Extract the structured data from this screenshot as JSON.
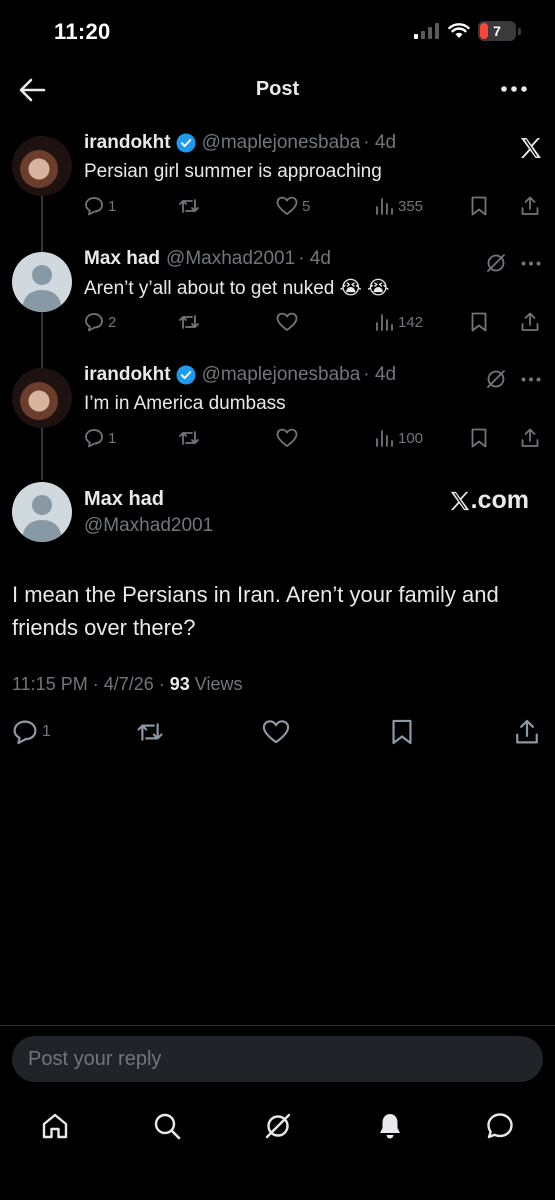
{
  "status": {
    "time": "11:20",
    "battery": "7",
    "battery_color": "#ff453a"
  },
  "nav": {
    "title": "Post",
    "back_icon": "arrow-left-icon",
    "more_icon": "more-horizontal-icon"
  },
  "thread": [
    {
      "name": "irandokht",
      "verified": true,
      "handle": "@maplejonesbaba",
      "time": "· 4d",
      "text": "Persian girl summer is approaching",
      "replies": "1",
      "reposts": "",
      "likes": "5",
      "views": "355"
    },
    {
      "name": "Max had",
      "verified": false,
      "handle": "@Maxhad2001",
      "time": "· 4d",
      "text": "Aren’t y’all about to get nuked 😭 😭",
      "replies": "2",
      "reposts": "",
      "likes": "",
      "views": "142"
    },
    {
      "name": "irandokht",
      "verified": true,
      "handle": "@maplejonesbaba",
      "time": "· 4d",
      "text": "I’m in America dumbass",
      "replies": "1",
      "reposts": "",
      "likes": "",
      "views": "100"
    }
  ],
  "main_post": {
    "name": "Max had",
    "handle": "@Maxhad2001",
    "watermark": ".com",
    "text": "I mean the Persians in Iran. Aren’t your family and friends over there?",
    "timestamp": "11:15 PM · 4/7/26 · ",
    "views_count": "93",
    "views_label": " Views",
    "replies": "1"
  },
  "reply": {
    "placeholder": "Post your reply"
  },
  "tabs": [
    "home-icon",
    "search-icon",
    "grok-icon",
    "notifications-bell-icon",
    "messages-icon"
  ],
  "colors": {
    "background": "#000000",
    "text": "#e7e9ea",
    "muted": "#71767b",
    "verified": "#1d9bf0"
  }
}
